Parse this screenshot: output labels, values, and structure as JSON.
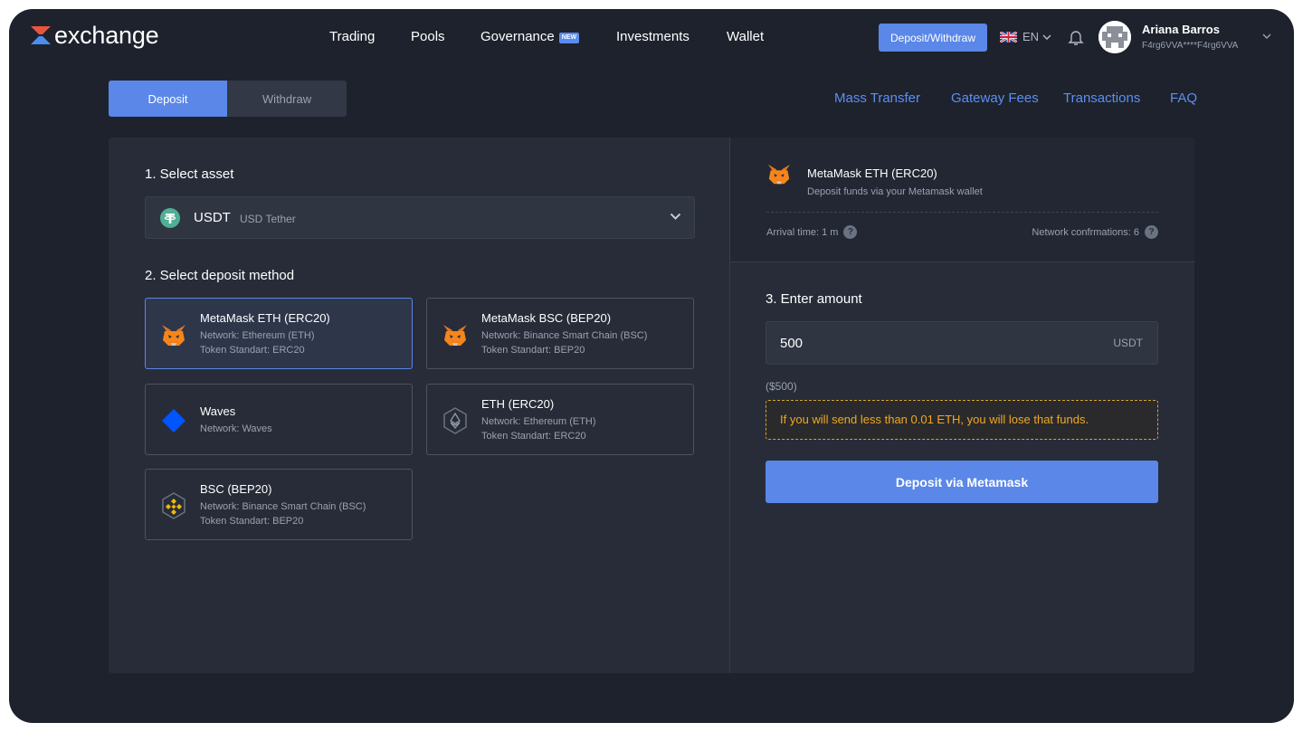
{
  "header": {
    "logo_text": "exchange",
    "nav": [
      {
        "label": "Trading"
      },
      {
        "label": "Pools"
      },
      {
        "label": "Governance",
        "badge": "NEW"
      },
      {
        "label": "Investments"
      },
      {
        "label": "Wallet"
      }
    ],
    "deposit_withdraw_label": "Deposit/Withdraw",
    "language": "EN",
    "user": {
      "name": "Ariana Barros",
      "id": "F4rg6VVA****F4rg6VVA"
    }
  },
  "tabs": [
    {
      "label": "Deposit",
      "active": true
    },
    {
      "label": "Withdraw",
      "active": false
    }
  ],
  "top_links": [
    "Mass Transfer",
    "Gateway Fees",
    "Transactions",
    "FAQ"
  ],
  "left": {
    "step1_label": "1. Select asset",
    "asset": {
      "symbol": "USDT",
      "name": "USD Tether"
    },
    "step2_label": "2. Select deposit method",
    "methods": [
      {
        "title": "MetaMask ETH (ERC20)",
        "line1": "Network: Ethereum (ETH)",
        "line2": "Token Standart: ERC20",
        "icon": "metamask-fox-icon",
        "selected": true
      },
      {
        "title": "MetaMask BSC (BEP20)",
        "line1": "Network: Binance Smart Chain (BSC)",
        "line2": "Token Standart: BEP20",
        "icon": "metamask-fox-icon",
        "selected": false
      },
      {
        "title": "Waves",
        "line1": "Network: Waves",
        "line2": "",
        "icon": "waves-diamond-icon",
        "selected": false
      },
      {
        "title": "ETH (ERC20)",
        "line1": "Network: Ethereum (ETH)",
        "line2": "Token Standart: ERC20",
        "icon": "ethereum-icon",
        "selected": false
      },
      {
        "title": "BSC (BEP20)",
        "line1": "Network: Binance Smart Chain (BSC)",
        "line2": "Token Standart: BEP20",
        "icon": "binance-icon",
        "selected": false
      }
    ]
  },
  "right": {
    "method_title": "MetaMask ETH (ERC20)",
    "method_sub": "Deposit funds via your Metamask wallet",
    "arrival_time": "Arrival time: 1 m",
    "confirmations": "Network confrmations: 6",
    "step3_label": "3. Enter amount",
    "amount_value": "500",
    "amount_unit": "USDT",
    "amount_usd": "($500)",
    "warning": "If you will send less than 0.01 ETH, you will lose that funds.",
    "deposit_button": "Deposit via Metamask"
  },
  "colors": {
    "background": "#1d222d",
    "panel": "#272c38",
    "accent": "#5a87e8",
    "link": "#5d8ff0",
    "warning": "#f0a824",
    "tether": "#50af95"
  }
}
